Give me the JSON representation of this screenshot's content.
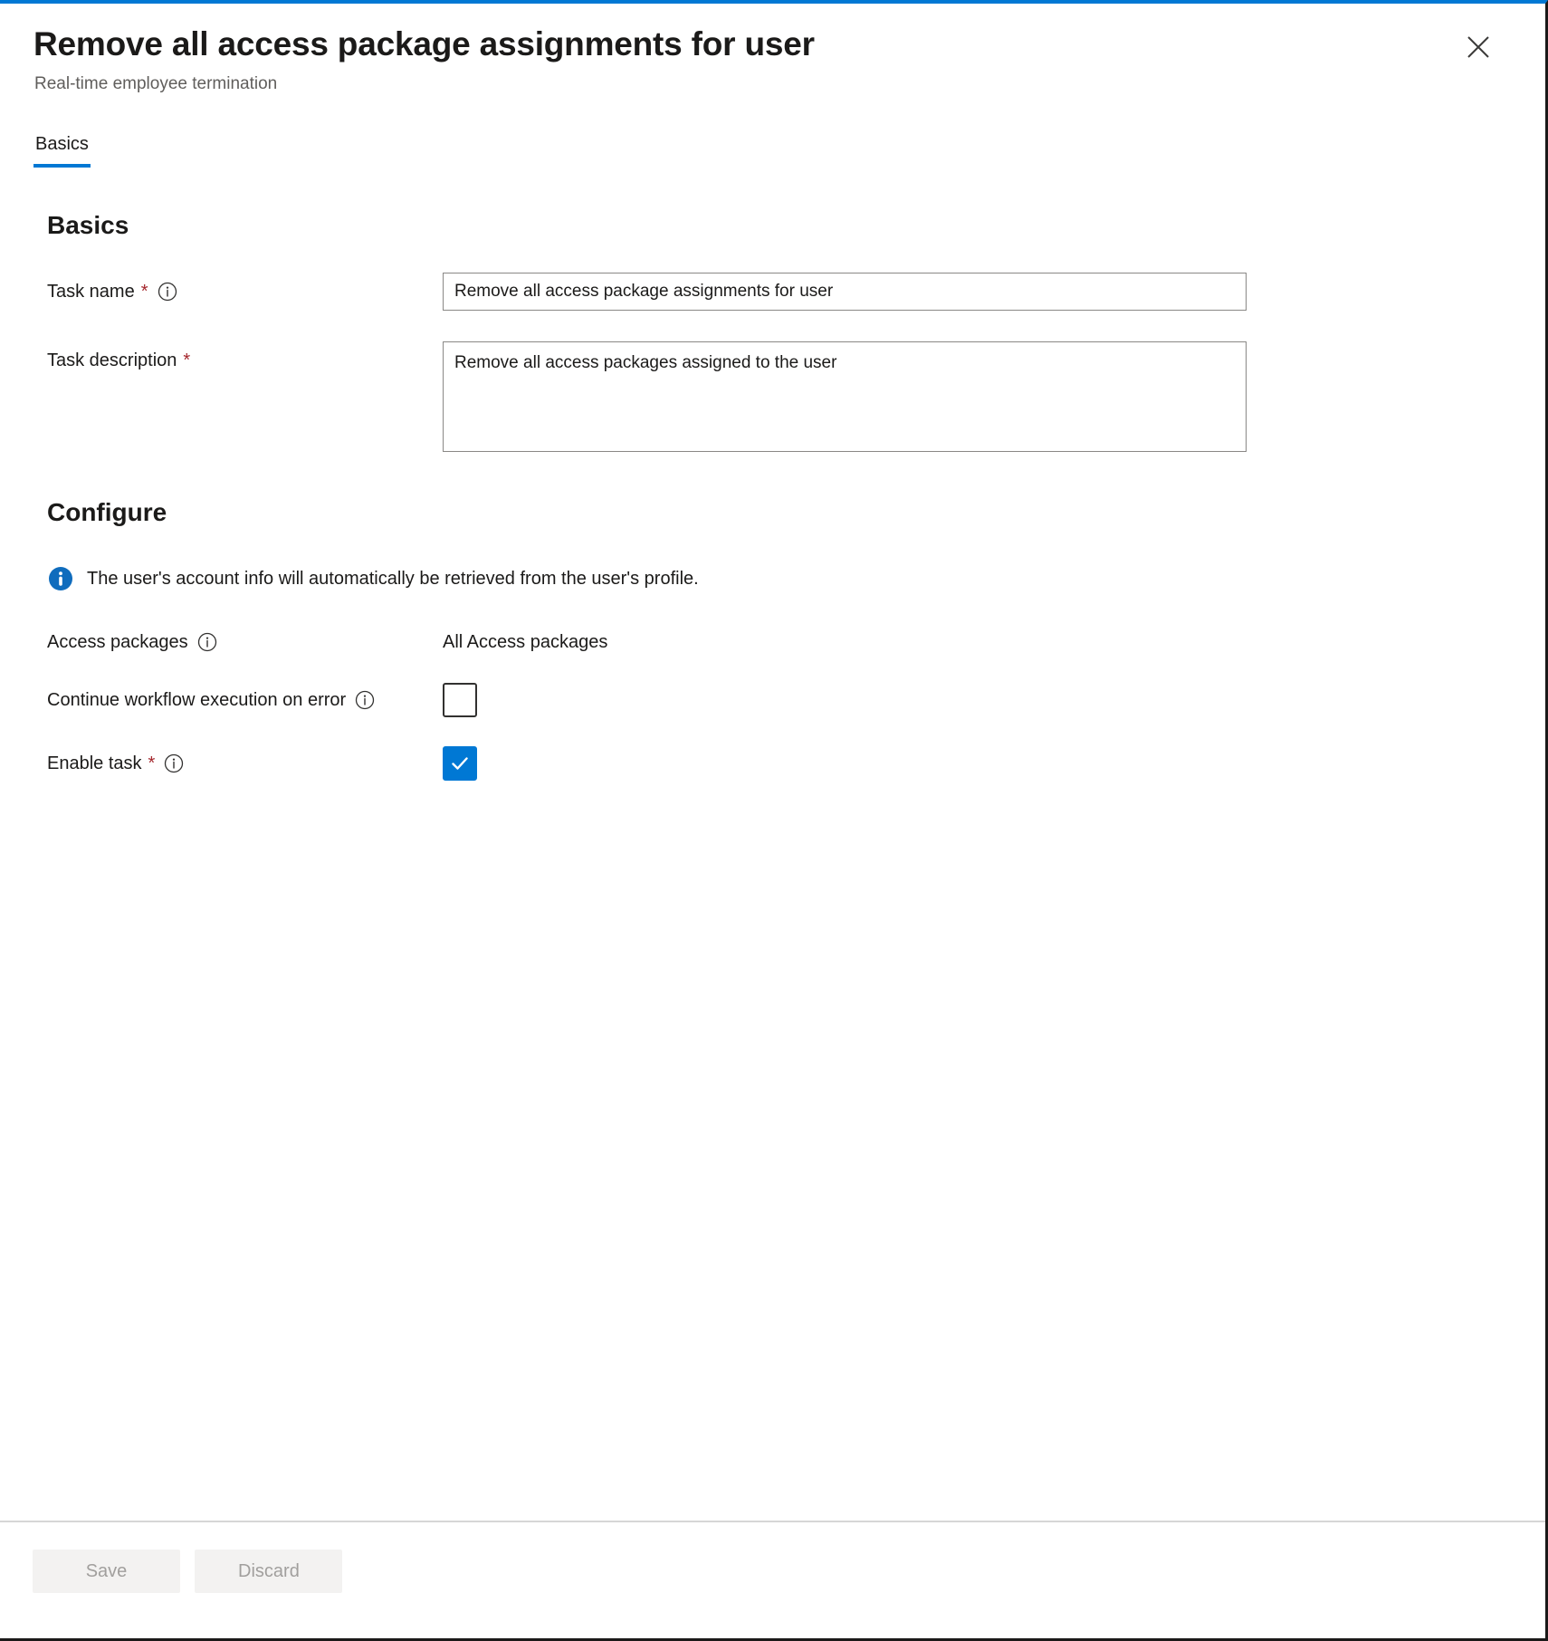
{
  "blade": {
    "title": "Remove all access package assignments for user",
    "subtitle": "Real-time employee termination",
    "close_icon": "close-icon",
    "accent_color": "#0078d4"
  },
  "tabs": [
    {
      "label": "Basics",
      "active": true
    }
  ],
  "sections": {
    "basics": {
      "heading": "Basics",
      "fields": {
        "task_name": {
          "label": "Task name",
          "required_marker": "*",
          "info_icon": "info-outline-icon",
          "value": "Remove all access package assignments for user",
          "placeholder": "Task name"
        },
        "task_description": {
          "label": "Task description",
          "required_marker": "*",
          "value": "Remove all access packages assigned to the user",
          "placeholder": "Task description"
        }
      }
    },
    "configure": {
      "heading": "Configure",
      "info_banner": {
        "icon": "info-filled-icon",
        "text": "The user's account info will automatically be retrieved from the user's profile.",
        "icon_color": "#0f6cbd"
      },
      "fields": {
        "access_packages": {
          "label": "Access packages",
          "info_icon": "info-outline-icon",
          "value": "All Access packages"
        },
        "continue_on_error": {
          "label": "Continue workflow execution on error",
          "info_icon": "info-outline-icon",
          "checked": false
        },
        "enable_task": {
          "label": "Enable task",
          "required_marker": "*",
          "info_icon": "info-outline-icon",
          "checked": true
        }
      }
    }
  },
  "footer": {
    "save_label": "Save",
    "discard_label": "Discard",
    "save_enabled": false,
    "discard_enabled": false
  }
}
